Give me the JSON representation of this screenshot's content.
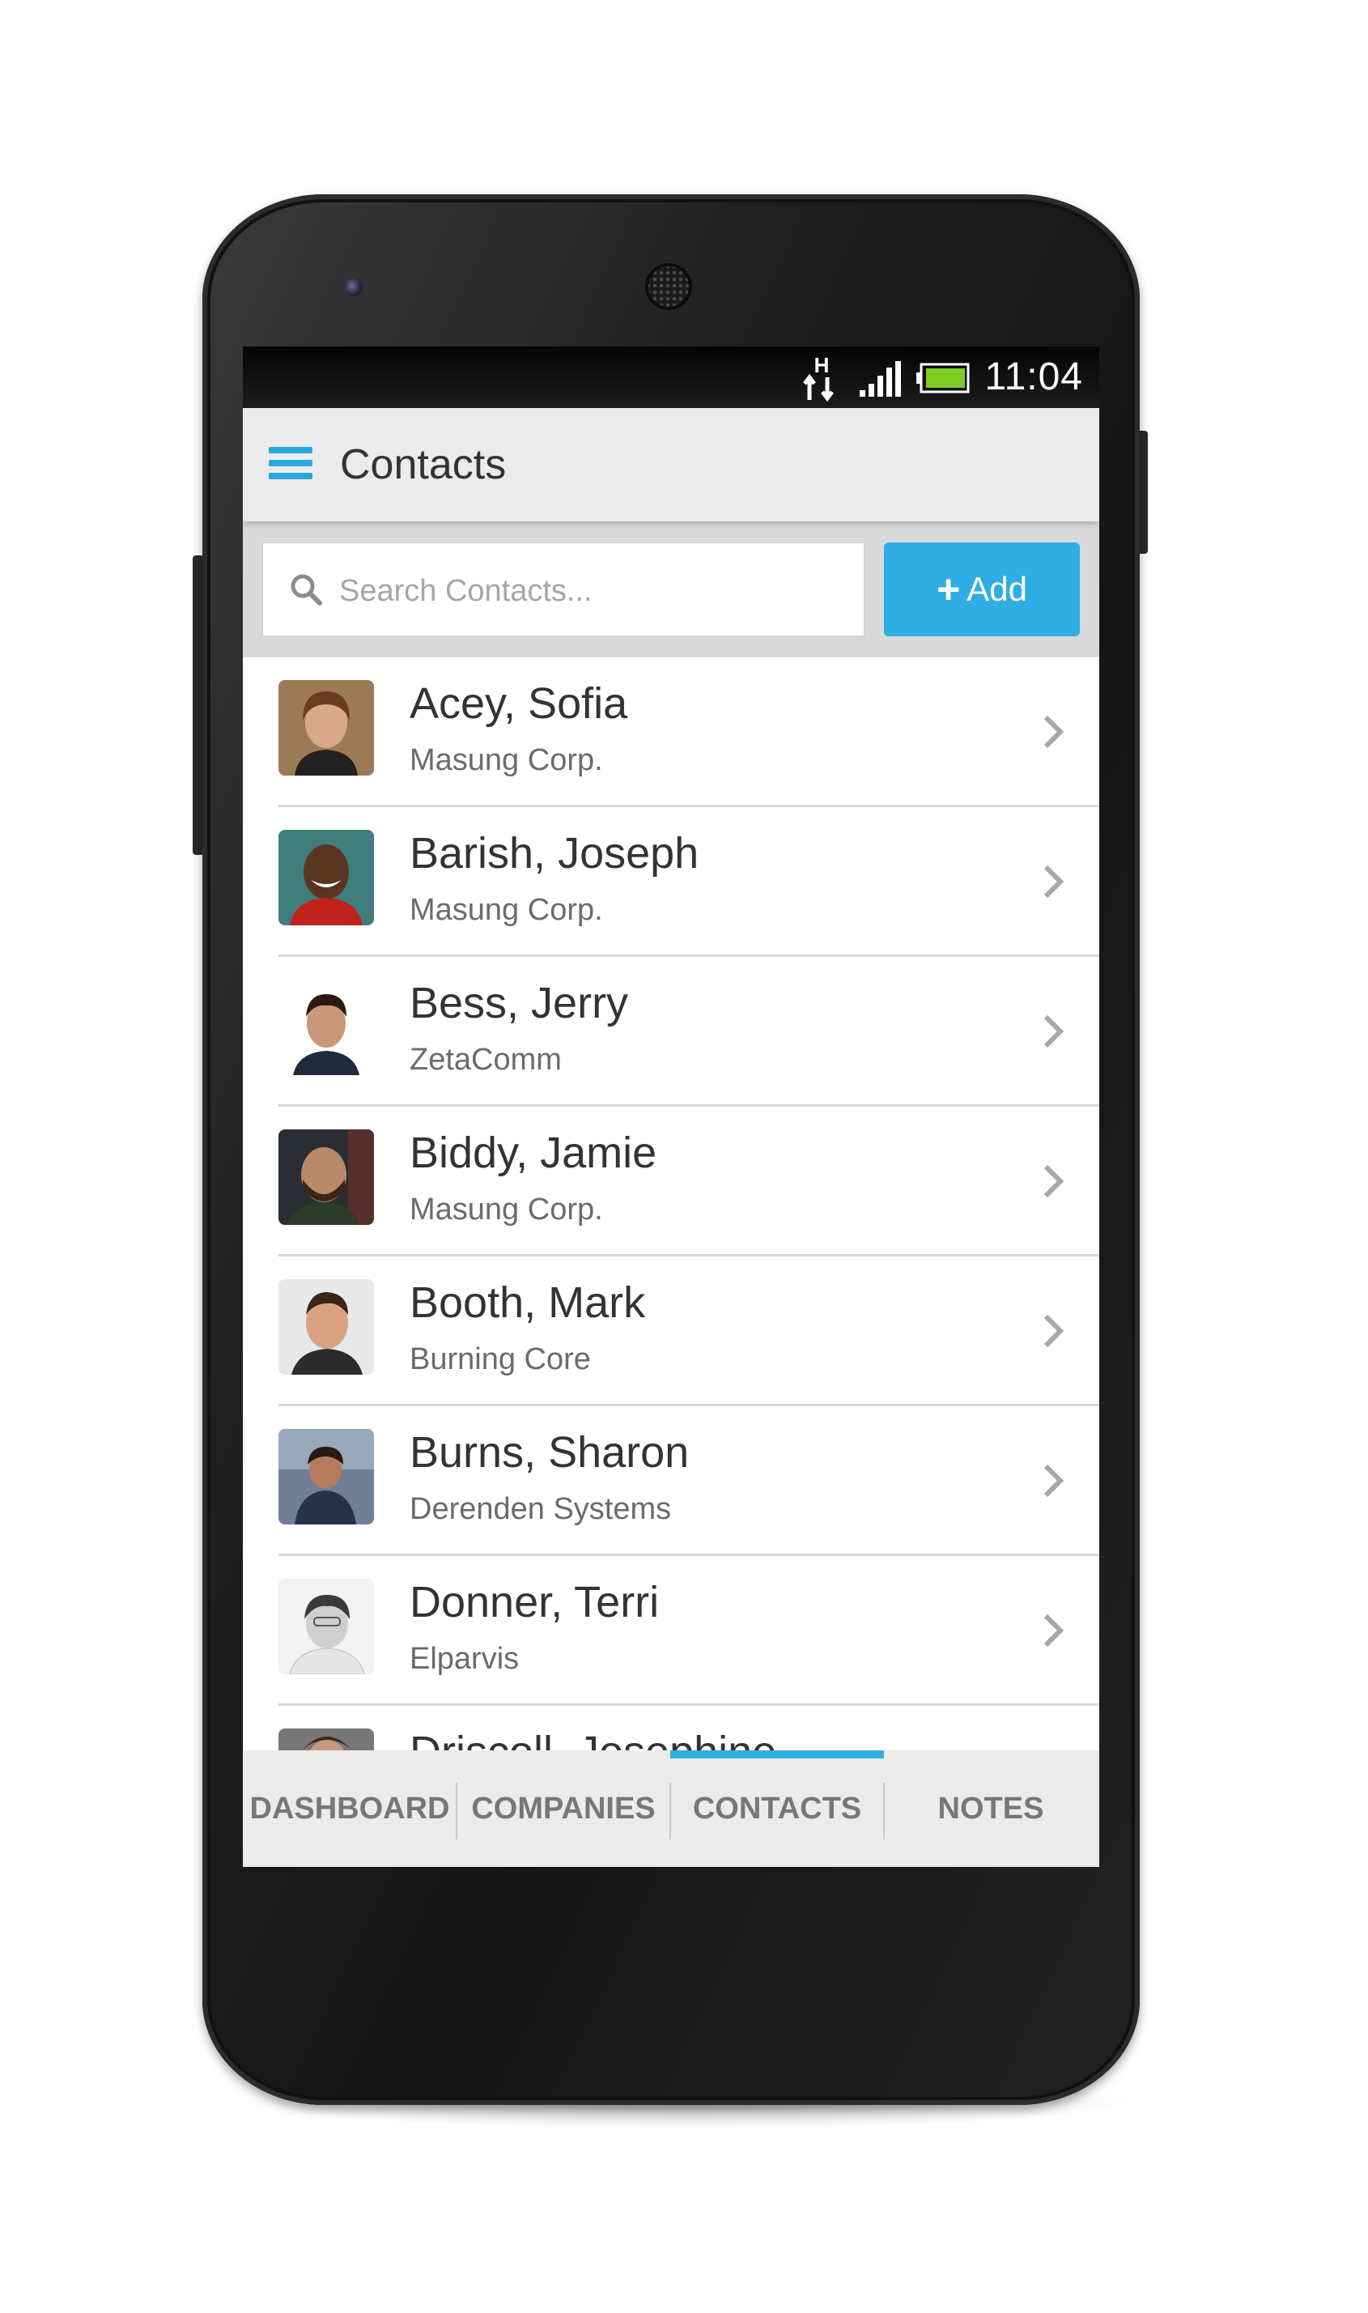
{
  "status_bar": {
    "time": "11:04",
    "network_type": "H",
    "icons": [
      "network-h-icon",
      "signal-icon",
      "battery-icon"
    ]
  },
  "app_bar": {
    "title": "Contacts",
    "menu_icon": "hamburger-menu-icon"
  },
  "search": {
    "placeholder": "Search Contacts...",
    "value": "",
    "icon": "search-icon"
  },
  "add_button": {
    "label": "Add",
    "icon": "plus-icon"
  },
  "contacts": [
    {
      "name": "Acey, Sofia",
      "company": "Masung Corp."
    },
    {
      "name": "Barish, Joseph",
      "company": "Masung Corp."
    },
    {
      "name": "Bess, Jerry",
      "company": "ZetaComm"
    },
    {
      "name": "Biddy, Jamie",
      "company": "Masung Corp."
    },
    {
      "name": "Booth, Mark",
      "company": "Burning Core"
    },
    {
      "name": "Burns, Sharon",
      "company": "Derenden Systems"
    },
    {
      "name": "Donner, Terri",
      "company": "Elparvis"
    },
    {
      "name": "Driscoll, Josephine",
      "company": ""
    }
  ],
  "bottom_nav": {
    "tabs": [
      {
        "label": "DASHBOARD"
      },
      {
        "label": "COMPANIES"
      },
      {
        "label": "CONTACTS",
        "active": true
      },
      {
        "label": "NOTES"
      }
    ]
  },
  "colors": {
    "accent": "#2eaee3",
    "app_bar": "#ebebeb",
    "search_row": "#d9d9d9",
    "text_primary": "#333333",
    "text_secondary": "#6b6b6b"
  }
}
